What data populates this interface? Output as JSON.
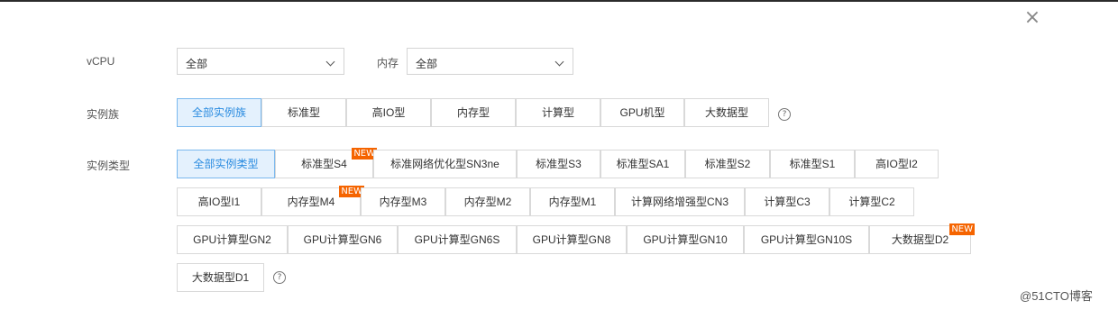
{
  "dialog": {
    "close_icon": "×"
  },
  "vcpu": {
    "label": "vCPU",
    "value": "全部"
  },
  "memory": {
    "label": "内存",
    "value": "全部"
  },
  "family": {
    "label": "实例族",
    "options": [
      "全部实例族",
      "标准型",
      "高IO型",
      "内存型",
      "计算型",
      "GPU机型",
      "大数据型"
    ],
    "selected": "全部实例族"
  },
  "types": {
    "label": "实例类型",
    "options": [
      "全部实例类型",
      "标准型S4",
      "标准网络优化型SN3ne",
      "标准型S3",
      "标准型SA1",
      "标准型S2",
      "标准型S1",
      "高IO型I2",
      "高IO型I1",
      "内存型M4",
      "内存型M3",
      "内存型M2",
      "内存型M1",
      "计算网络增强型CN3",
      "计算型C3",
      "计算型C2",
      "GPU计算型GN2",
      "GPU计算型GN6",
      "GPU计算型GN6S",
      "GPU计算型GN8",
      "GPU计算型GN10",
      "GPU计算型GN10S",
      "大数据型D2",
      "大数据型D1"
    ],
    "selected": "全部实例类型",
    "new_badge": "NEW"
  },
  "help_icon": "?",
  "watermark": "@51CTO博客",
  "colors": {
    "active_bg": "#e4f1fd",
    "active_border": "#7ab8ee",
    "active_text": "#2b8ce0",
    "new_badge": "#f56400"
  }
}
